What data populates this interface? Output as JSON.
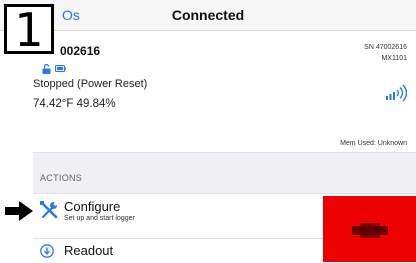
{
  "navbar": {
    "back_label": "Os",
    "title": "Connected"
  },
  "step_badge": "1",
  "device": {
    "id_partial": "002616",
    "status": "Stopped (Power Reset)",
    "readings": "74.42°F  49.84%",
    "serial": "SN 47002616",
    "model": "MX1101",
    "memory": "Mem Used: Unknown",
    "icons": [
      "lock-open-icon",
      "battery-icon",
      "signal-icon"
    ]
  },
  "actions": {
    "header": "ACTIONS",
    "items": [
      {
        "label": "Configure",
        "subtitle": "Set up and start logger",
        "icon": "wrench-screwdriver-icon"
      },
      {
        "label": "Readout",
        "icon": "download-circle-icon"
      }
    ]
  },
  "colors": {
    "accent": "#2a7ae2",
    "redaction": "#ee0000"
  }
}
